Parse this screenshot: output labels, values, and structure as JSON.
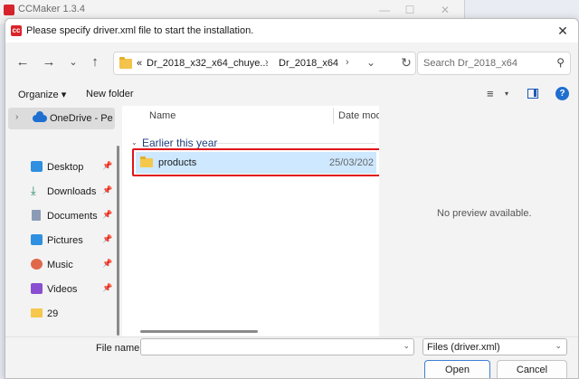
{
  "background_window": {
    "title": "CCMaker 1.3.4"
  },
  "dialog": {
    "title": "Please specify driver.xml file to start the installation."
  },
  "address_bar": {
    "overflow": "«",
    "crumbs": [
      "Dr_2018_x32_x64_chuye...",
      "Dr_2018_x64"
    ]
  },
  "search": {
    "placeholder": "Search Dr_2018_x64"
  },
  "command_bar": {
    "organize_label": "Organize ▾",
    "new_folder_label": "New folder"
  },
  "nav_pane": {
    "onedrive_label": "OneDrive - Perso",
    "items": [
      {
        "label": "Desktop",
        "icon": "desktop-icon"
      },
      {
        "label": "Downloads",
        "icon": "download-icon"
      },
      {
        "label": "Documents",
        "icon": "documents-icon"
      },
      {
        "label": "Pictures",
        "icon": "pictures-icon"
      },
      {
        "label": "Music",
        "icon": "music-icon"
      },
      {
        "label": "Videos",
        "icon": "videos-icon"
      },
      {
        "label": "29",
        "icon": "folder-icon"
      }
    ]
  },
  "file_list": {
    "col_name": "Name",
    "col_date": "Date mod",
    "group_label": "Earlier this year",
    "rows": [
      {
        "name": "products",
        "date": "25/03/202"
      }
    ]
  },
  "preview": {
    "message": "No preview available."
  },
  "bottom": {
    "file_name_label": "File name:",
    "file_name_value": "",
    "file_type": "Files (driver.xml)",
    "open_label": "Open",
    "cancel_label": "Cancel"
  },
  "colors": {
    "accent": "#1e6fd0",
    "selection": "#cde8ff",
    "highlight_box": "#e0141b"
  }
}
